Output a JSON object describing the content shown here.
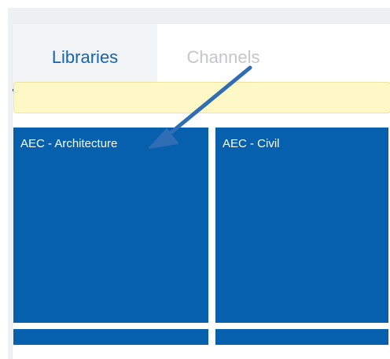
{
  "tabs": {
    "libraries_label": "Libraries",
    "channels_label": "Channels",
    "active": "Libraries"
  },
  "notice": {
    "text": ""
  },
  "tiles": [
    {
      "label": "AEC - Architecture"
    },
    {
      "label": "AEC - Civil"
    },
    {
      "label": ""
    },
    {
      "label": ""
    }
  ],
  "annotation": {
    "icon": "arrow-pointer-icon",
    "color": "#2f6eb5"
  },
  "colors": {
    "tile_blue": "#0760ae",
    "active_tab_text": "#1564ad",
    "inactive_tab_text": "#c4c6c9",
    "notice_bg": "#fdf8c5"
  }
}
